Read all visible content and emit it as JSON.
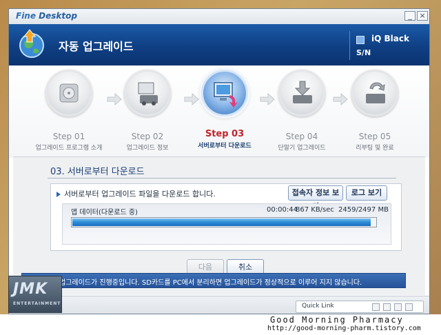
{
  "window": {
    "app_title_fine": "Fine",
    "app_title_rest": " Desktop",
    "min_glyph": "_",
    "close_glyph": "×"
  },
  "header": {
    "title": "자동 업그레이드",
    "device_name": "iQ Black",
    "sn_label": "S/N",
    "logo_icon": "globe-upgrade-icon"
  },
  "steps": [
    {
      "number": "Step 01",
      "label": "업그레이드 프로그램 소개",
      "icon": "disc-icon",
      "active": false
    },
    {
      "number": "Step 02",
      "label": "업그레이드 정보",
      "icon": "device-monitor-icon",
      "active": false
    },
    {
      "number": "Step 03",
      "label": "서버로부터 다운로드",
      "icon": "download-monitor-icon",
      "active": true
    },
    {
      "number": "Step 04",
      "label": "단말기 업그레이드",
      "icon": "device-down-arrow-icon",
      "active": false
    },
    {
      "number": "Step 05",
      "label": "리부팅 및 완료",
      "icon": "refresh-device-icon",
      "active": false
    }
  ],
  "content": {
    "section_title": "03. 서버로부터 다운로드",
    "message": "서버로부터 업그레이드 파일을 다운로드 합니다.",
    "user_info_button": "접속자 정보 보기",
    "log_button": "로그 보기",
    "progress": {
      "label": "앱 데이터(다운로드 중)",
      "elapsed": "00:00:44",
      "speed": "867 KB/sec",
      "size": "2459/2497 MB",
      "fraction": 0.985
    },
    "next_button": "다음",
    "cancel_button": "취소"
  },
  "status_bar": {
    "text": "업그레이드가 진행중입니다. SD카드를 PC에서 분리하면 업그레이드가 정상적으로 이루어 지지 않습니다."
  },
  "quick_link": {
    "label": "Quick Link"
  },
  "watermark": {
    "logo_main": "JMK",
    "logo_sub": "ENTERTAINMENT",
    "title": "Good Morning Pharmacy",
    "url": "http://good-morning-pharm.tistory.com"
  },
  "colors": {
    "header_blue": "#0f3f83",
    "active_step_red": "#c0232a",
    "progress_blue": "#2e8fd8",
    "status_bar_blue": "#26539a"
  }
}
